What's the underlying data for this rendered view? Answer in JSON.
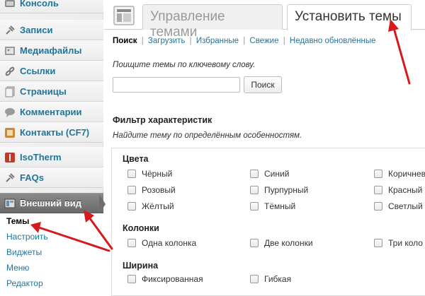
{
  "sidebar": {
    "items": [
      {
        "label": "Консоль",
        "icon": "dashboard-icon"
      },
      {
        "label": "Записи",
        "icon": "pin-icon"
      },
      {
        "label": "Медиафайлы",
        "icon": "media-icon"
      },
      {
        "label": "Ссылки",
        "icon": "link-icon"
      },
      {
        "label": "Страницы",
        "icon": "pages-icon"
      },
      {
        "label": "Комментарии",
        "icon": "comment-icon"
      },
      {
        "label": "Контакты (CF7)",
        "icon": "contacts-icon"
      },
      {
        "label": "IsoTherm",
        "icon": "isotherm-icon"
      },
      {
        "label": "FAQs",
        "icon": "pin-icon"
      },
      {
        "label": "Внешний вид",
        "icon": "appearance-icon"
      }
    ],
    "submenu": [
      "Темы",
      "Настроить",
      "Виджеты",
      "Меню",
      "Редактор"
    ]
  },
  "tabs": [
    "Управление темами",
    "Установить темы"
  ],
  "subnav": {
    "current": "Поиск",
    "links": [
      "Загрузить",
      "Избранные",
      "Свежие",
      "Недавно обновлённые"
    ],
    "separator": "|"
  },
  "search": {
    "hint": "Поищите темы по ключевому слову.",
    "value": "",
    "button": "Поиск"
  },
  "filter": {
    "title": "Фильтр характеристик",
    "hint": "Найдите тему по определённым особенностям.",
    "groups": {
      "colors": {
        "title": "Цвета",
        "options": [
          "Чёрный",
          "Синий",
          "Коричнев",
          "Розовый",
          "Пурпурный",
          "Красный",
          "Жёлтый",
          "Тёмный",
          "Светлый"
        ]
      },
      "columns": {
        "title": "Колонки",
        "options": [
          "Одна колонка",
          "Две колонки",
          "Три коло"
        ]
      },
      "width": {
        "title": "Ширина",
        "options": [
          "Фиксированная",
          "Гибкая"
        ]
      }
    }
  },
  "colors": {
    "link": "#21759b",
    "annotation_arrow": "#d7191c",
    "active_menu": "#777777"
  }
}
